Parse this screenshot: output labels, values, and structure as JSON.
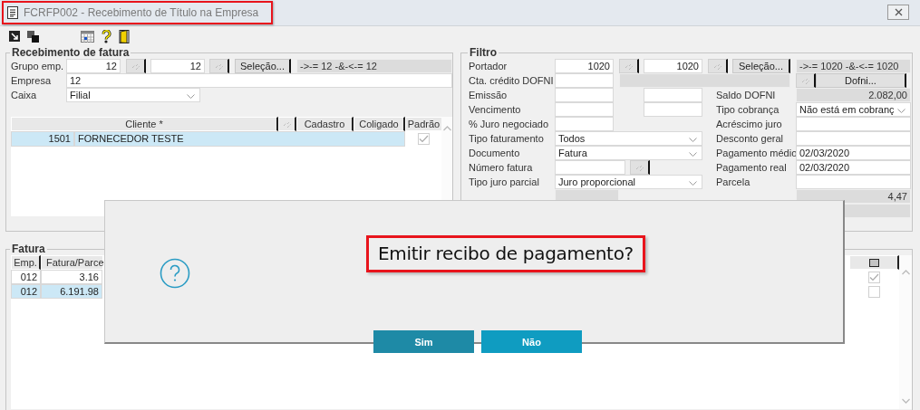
{
  "window": {
    "title": "FCRFP002 - Recebimento de Título na Empresa"
  },
  "recebimento": {
    "title": "Recebimento de fatura",
    "grupo_emp": {
      "label": "Grupo emp.",
      "from": "12",
      "to": "12",
      "selection_button": "Seleção...",
      "range": "->-= 12 -&-<-= 12"
    },
    "empresa": {
      "label": "Empresa",
      "value": "12"
    },
    "caixa": {
      "label": "Caixa",
      "value": "Filial"
    },
    "grid": {
      "columns": [
        "Cliente *",
        "Cadastro",
        "Coligado",
        "Padrão"
      ],
      "rows": [
        {
          "code": "1501",
          "name": "FORNECEDOR TESTE",
          "padrao": true,
          "selected": true
        }
      ]
    }
  },
  "filtro": {
    "title": "Filtro",
    "portador": {
      "label": "Portador",
      "from": "1020",
      "to": "1020",
      "selection_button": "Seleção...",
      "range": "->-= 1020 -&-<-= 1020"
    },
    "cta_credito": {
      "label": "Cta. crédito DOFNI",
      "button": "Dofni..."
    },
    "rows": [
      {
        "left": {
          "kind": "range",
          "label": "Emissão"
        },
        "right": {
          "kind": "readonly",
          "label": "Saldo DOFNI",
          "value": "2.082,00"
        }
      },
      {
        "left": {
          "kind": "range",
          "label": "Vencimento"
        },
        "right": {
          "kind": "select",
          "label": "Tipo cobrança",
          "value": "Não está em cobranç"
        }
      },
      {
        "left": {
          "kind": "input",
          "label": "% Juro negociado"
        },
        "right": {
          "kind": "input",
          "label": "Acréscimo juro"
        }
      },
      {
        "left": {
          "kind": "select",
          "label": "Tipo faturamento",
          "value": "Todos"
        },
        "right": {
          "kind": "input",
          "label": "Desconto geral"
        }
      },
      {
        "left": {
          "kind": "select",
          "label": "Documento",
          "value": "Fatura"
        },
        "right": {
          "kind": "input",
          "label": "Pagamento médio",
          "value": "02/03/2020"
        }
      },
      {
        "left": {
          "kind": "lookup",
          "label": "Número fatura"
        },
        "right": {
          "kind": "input",
          "label": "Pagamento real",
          "value": "02/03/2020"
        }
      },
      {
        "left": {
          "kind": "select",
          "label": "Tipo juro parcial",
          "value": "Juro proporcional"
        },
        "right": {
          "kind": "input",
          "label": "Parcela"
        }
      },
      {
        "left": {
          "kind": "readonly"
        },
        "right": {
          "kind": "readonly",
          "value": "4,47"
        }
      }
    ]
  },
  "fatura": {
    "title": "Fatura",
    "columns": [
      "Emp.",
      "Fatura/Parce"
    ],
    "rows": [
      {
        "emp": "012",
        "fatura": "3.16",
        "checked": true,
        "selected": false
      },
      {
        "emp": "012",
        "fatura": "6.191.98",
        "checked": false,
        "selected": true
      }
    ]
  },
  "dialog": {
    "message": "Emitir recibo de pagamento?",
    "buttons": [
      "Sim",
      "Não"
    ]
  }
}
